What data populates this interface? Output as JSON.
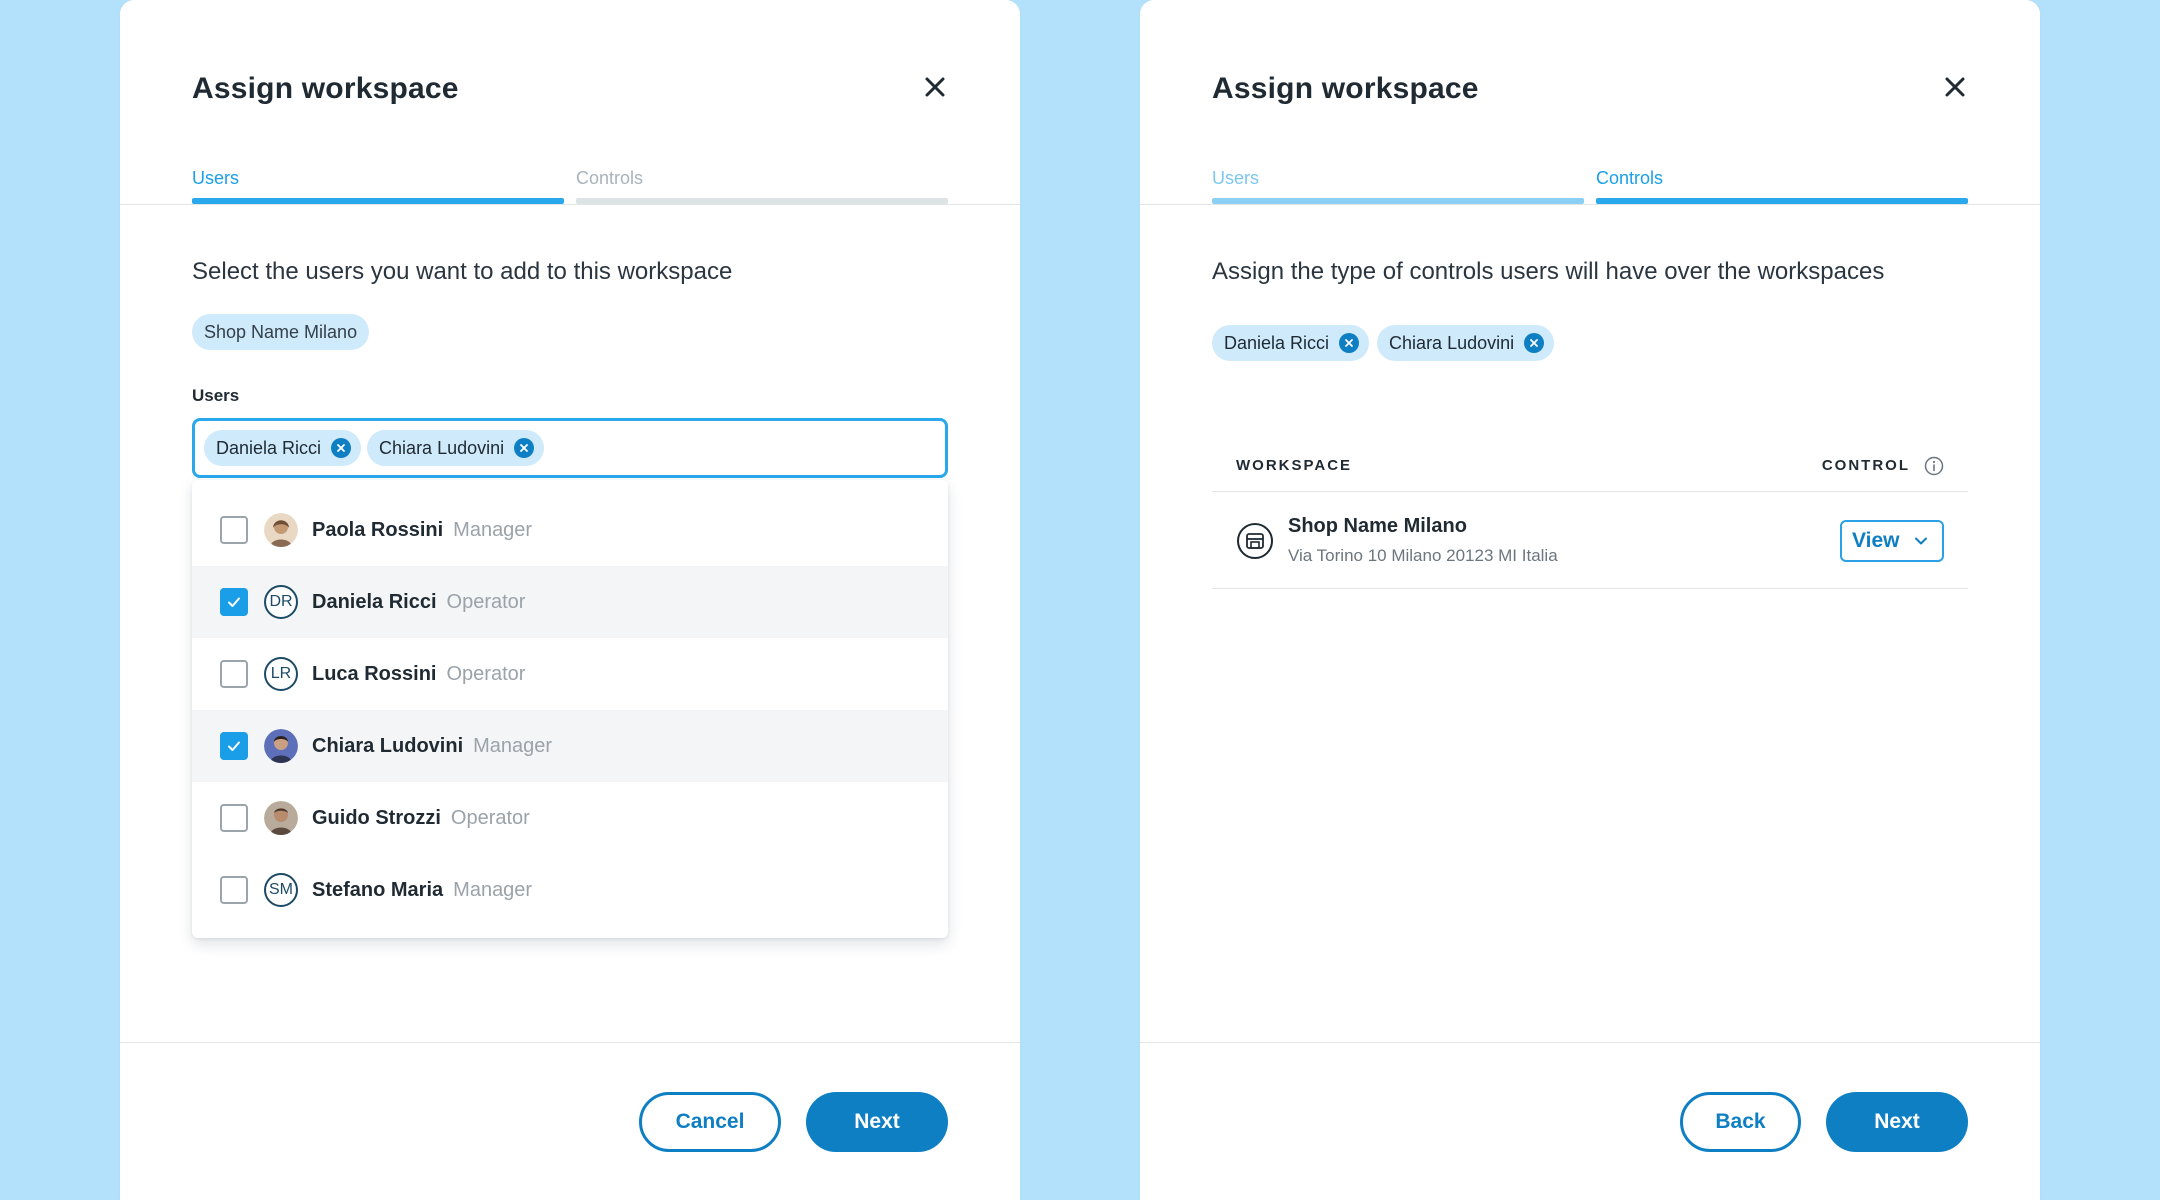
{
  "colors": {
    "background": "#b3e0fb",
    "accent": "#2aa8ec",
    "primary_button": "#0f7fc4",
    "chip_bg": "#cfeafb"
  },
  "left_panel": {
    "title": "Assign workspace",
    "close_icon": "close-icon",
    "tabs": [
      {
        "label": "Users",
        "state": "active"
      },
      {
        "label": "Controls",
        "state": "inactive"
      }
    ],
    "instruction": "Select the users you want to add to this workspace",
    "workspace_chip": "Shop Name Milano",
    "users_field": {
      "label": "Users",
      "selected_chips": [
        "Daniela Ricci",
        "Chiara Ludovini"
      ]
    },
    "options": [
      {
        "name": "Paola Rossini",
        "role": "Manager",
        "checked": false,
        "avatar": "photo",
        "initials": ""
      },
      {
        "name": "Daniela Ricci",
        "role": "Operator",
        "checked": true,
        "avatar": "initials",
        "initials": "DR"
      },
      {
        "name": "Luca Rossini",
        "role": "Operator",
        "checked": false,
        "avatar": "initials",
        "initials": "LR"
      },
      {
        "name": "Chiara Ludovini",
        "role": "Manager",
        "checked": true,
        "avatar": "photo",
        "initials": ""
      },
      {
        "name": "Guido Strozzi",
        "role": "Operator",
        "checked": false,
        "avatar": "photo",
        "initials": ""
      },
      {
        "name": "Stefano Maria",
        "role": "Manager",
        "checked": false,
        "avatar": "initials",
        "initials": "SM"
      }
    ],
    "footer": {
      "cancel_label": "Cancel",
      "next_label": "Next"
    }
  },
  "right_panel": {
    "title": "Assign workspace",
    "close_icon": "close-icon",
    "tabs": [
      {
        "label": "Users",
        "state": "done"
      },
      {
        "label": "Controls",
        "state": "active"
      }
    ],
    "instruction": "Assign the type of controls users will have over the workspaces",
    "selected_chips": [
      "Daniela Ricci",
      "Chiara Ludovini"
    ],
    "table": {
      "col_workspace": "WORKSPACE",
      "col_control": "CONTROL",
      "info_icon": "info-icon",
      "rows": [
        {
          "name": "Shop Name Milano",
          "address": "Via Torino 10 Milano 20123 MI Italia",
          "control": "View",
          "icon": "store-icon"
        }
      ]
    },
    "footer": {
      "back_label": "Back",
      "next_label": "Next"
    }
  }
}
